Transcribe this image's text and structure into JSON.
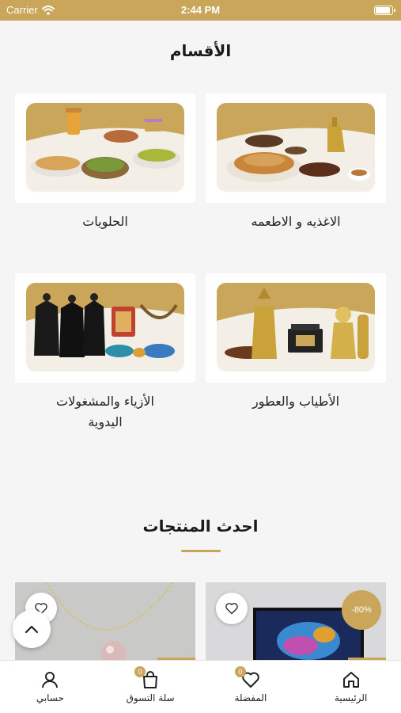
{
  "status_bar": {
    "carrier": "Carrier",
    "time": "2:44 PM"
  },
  "categories_section": {
    "title": "الأقسام",
    "items": [
      {
        "label": "الاغذيه و الاطعمه",
        "image": "food-dates-coffee"
      },
      {
        "label": "الحلويات",
        "image": "sweets-platters"
      },
      {
        "label": "الأطياب والعطور",
        "image": "incense-perfume"
      },
      {
        "label_line1": "الأزياء والمشغولات",
        "label_line2": "اليدوية",
        "image": "fashion-handicrafts"
      }
    ]
  },
  "latest_section": {
    "title": "احدث المنتجات",
    "products": [
      {
        "discount": "-80%",
        "image": "television",
        "fav_icon": "heart-icon"
      },
      {
        "image": "pearl-necklace",
        "fav_icon": "heart-icon"
      }
    ]
  },
  "tabbar": {
    "items": [
      {
        "label": "الرئيسية",
        "icon": "home-icon"
      },
      {
        "label": "المفضلة",
        "icon": "heart-icon",
        "badge": "0"
      },
      {
        "label": "سلة التسوق",
        "icon": "cart-icon",
        "badge": "0"
      },
      {
        "label": "حسابي",
        "icon": "user-icon"
      }
    ]
  },
  "colors": {
    "accent": "#c9a65a",
    "background": "#f5f5f5",
    "text": "#1a1a1a"
  }
}
